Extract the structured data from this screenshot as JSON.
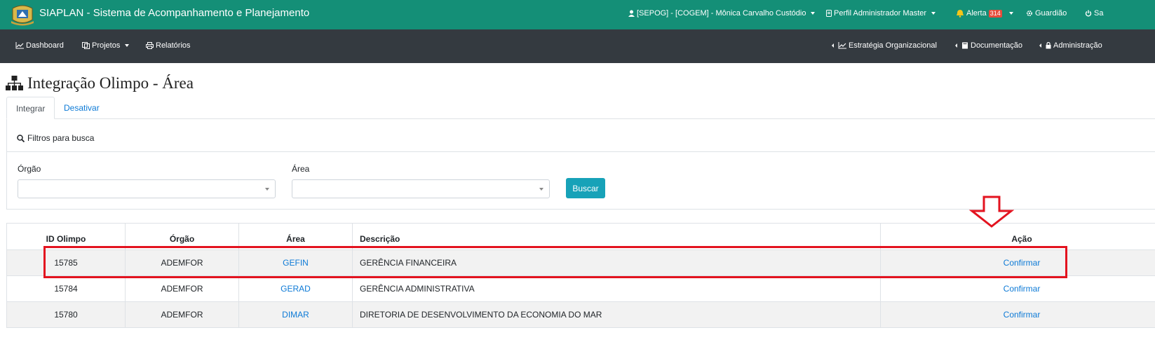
{
  "header": {
    "app_title": "SIAPLAN - Sistema de Acompanhamento e Planejamento",
    "user": "[SEPOG] - [COGEM] - Mônica Carvalho Custódio",
    "profile": "Perfil Administrador Master",
    "alert_label": "Alerta",
    "alert_count": "314",
    "guardian": "Guardião",
    "exit": "Sa"
  },
  "navbar": {
    "dashboard": "Dashboard",
    "projetos": "Projetos",
    "relatorios": "Relatórios",
    "estrategia": "Estratégia Organizacional",
    "documentacao": "Documentação",
    "administracao": "Administração"
  },
  "page": {
    "title": "Integração Olimpo - Área"
  },
  "tabs": {
    "integrar": "Integrar",
    "desativar": "Desativar"
  },
  "filters": {
    "heading": "Filtros para busca",
    "orgao_label": "Órgão",
    "orgao_value": "",
    "area_label": "Área",
    "area_value": "",
    "search_button": "Buscar"
  },
  "table": {
    "headers": {
      "id": "ID Olimpo",
      "orgao": "Órgão",
      "area": "Área",
      "descricao": "Descrição",
      "acao": "Ação"
    },
    "rows": [
      {
        "id": "15785",
        "orgao": "ADEMFOR",
        "area": "GEFIN",
        "descricao": "GERÊNCIA FINANCEIRA",
        "acao": "Confirmar"
      },
      {
        "id": "15784",
        "orgao": "ADEMFOR",
        "area": "GERAD",
        "descricao": "GERÊNCIA ADMINISTRATIVA",
        "acao": "Confirmar"
      },
      {
        "id": "15780",
        "orgao": "ADEMFOR",
        "area": "DIMAR",
        "descricao": "DIRETORIA DE DESENVOLVIMENTO DA ECONOMIA DO MAR",
        "acao": "Confirmar"
      }
    ]
  },
  "colors": {
    "header_bg": "#148f77",
    "navbar_bg": "#343a40",
    "link": "#0d7ad6",
    "button": "#17a2b8",
    "highlight": "#e3131f"
  }
}
